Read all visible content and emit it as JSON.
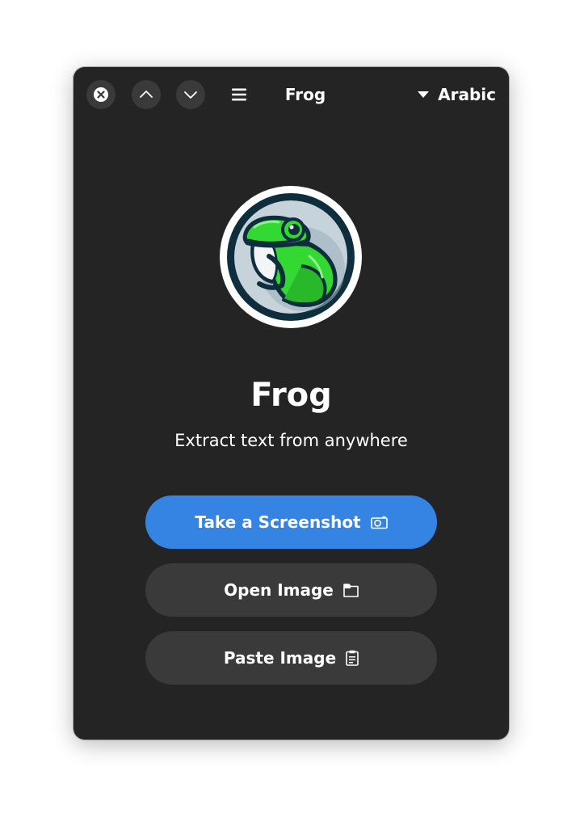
{
  "header": {
    "title": "Frog",
    "language": "Arabic",
    "icons": {
      "close": "close-icon",
      "previous": "chevron-up-icon",
      "next": "chevron-down-icon",
      "menu": "hamburger-menu-icon",
      "language_dropdown": "caret-down-icon"
    }
  },
  "main": {
    "app_name": "Frog",
    "tagline": "Extract text from anywhere",
    "logo": "frog-logo",
    "actions": [
      {
        "label": "Take a Screenshot",
        "icon": "camera-icon",
        "style": "primary"
      },
      {
        "label": "Open Image",
        "icon": "folder-icon",
        "style": "secondary"
      },
      {
        "label": "Paste Image",
        "icon": "clipboard-icon",
        "style": "secondary"
      }
    ]
  },
  "colors": {
    "window_bg": "#242424",
    "button_bg": "#3a3a3a",
    "accent": "#3584e4",
    "text": "#ffffff"
  }
}
